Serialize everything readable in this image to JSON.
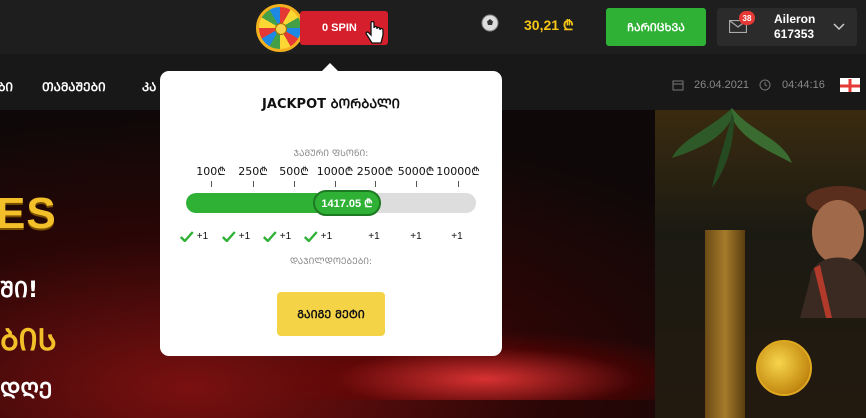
{
  "header": {
    "spin_label": "0 SPIN",
    "balance": "30,21 ₾",
    "deposit_label": "ᲩᲐᲠᲘᲪᲮᲕᲐ",
    "mail_count": "38",
    "username": "Aileron",
    "user_id": "617353"
  },
  "nav": {
    "items": [
      "ᲑᲘ",
      "ᲗᲐᲛᲐᲨᲔᲑᲘ",
      "ᲙᲐ"
    ],
    "date": "26.04.2021",
    "time": "04:44:16"
  },
  "banner": {
    "line1": "ES",
    "line2": "ᲨᲘ!",
    "line3": "ᲑᲘᲡ",
    "line4": "ᲓᲦᲔ"
  },
  "jackpot_popup": {
    "title": "JACKPOT ᲑᲝᲠᲑᲐᲚᲘ",
    "game_fund_label": "ᲯᲐᲛᲣᲠᲘ ᲤᲡᲝᲜᲘ:",
    "thresholds": [
      "100₾",
      "250₾",
      "500₾",
      "1000₾",
      "2500₾",
      "5000₾",
      "10000₾"
    ],
    "current_value": "1417.05 ₾",
    "progress": 0.45,
    "rewards": [
      {
        "label": "+1",
        "achieved": true
      },
      {
        "label": "+1",
        "achieved": true
      },
      {
        "label": "+1",
        "achieved": true
      },
      {
        "label": "+1",
        "achieved": true
      },
      {
        "label": "+1",
        "achieved": false
      },
      {
        "label": "+1",
        "achieved": false
      },
      {
        "label": "+1",
        "achieved": false
      }
    ],
    "rewards_label": "ᲓᲐᲯᲘᲚᲓᲝᲔᲑᲔᲑᲘ:",
    "more_button": "ᲒᲐᲘᲒᲔ ᲛᲔᲢᲘ"
  },
  "colors": {
    "accent_green": "#2fb136",
    "spin_red": "#d61f2c",
    "balance_gold": "#f5c518",
    "more_yellow": "#f5d347"
  }
}
